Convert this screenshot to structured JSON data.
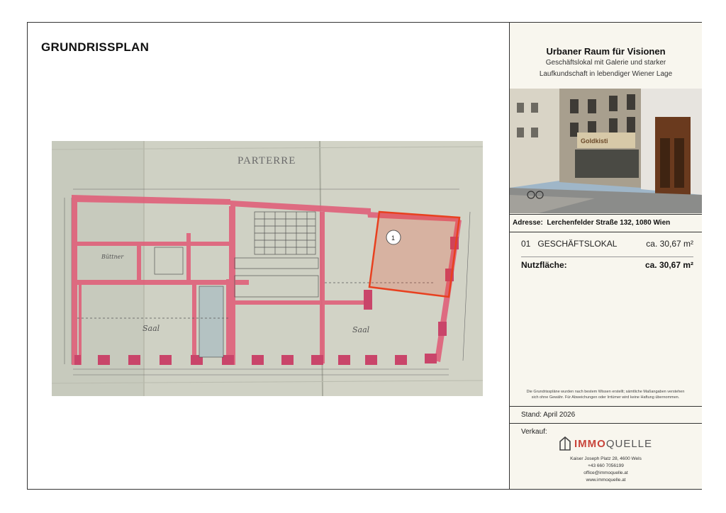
{
  "page": {
    "title": "GRUNDRISSPLAN"
  },
  "plan": {
    "label": "PARTERRE",
    "room_left": "Saal",
    "room_right": "Saal",
    "marker": "1",
    "room_small_left": "Büttner"
  },
  "sidebar": {
    "title": "Urbaner Raum für Visionen",
    "subtitle_1": "Geschäftslokal mit Galerie und starker",
    "subtitle_2": "Laufkundschaft in lebendiger Wiener Lage",
    "photo": {
      "shop_sign": "Goldkisti"
    },
    "address_label": "Adresse:",
    "address_value": "Lerchenfelder Straße 132, 1080 Wien",
    "unit": {
      "number": "01",
      "name": "GESCHÄFTSLOKAL",
      "area": "ca. 30,67 m²"
    },
    "usable_label": "Nutzfläche:",
    "usable_value": "ca. 30,67 m²",
    "disclaimer_1": "Die Grundrisspläne wurden nach bestem Wissen erstellt; sämtliche Maßangaben verstehen",
    "disclaimer_2": "sich ohne Gewähr. Für Abweichungen oder Irrtümer wird keine Haftung übernommen.",
    "stand": "Stand: April 2026",
    "verkauf": "Verkauf:",
    "logo_a": "IMMO",
    "logo_b": "QUELLE",
    "contact": {
      "street": "Kaiser Joseph Platz 28, 4600 Wels",
      "phone": "+43 660 7056199",
      "email": "office@immoquelle.at",
      "web": "www.immoquelle.at"
    }
  },
  "colors": {
    "wall": "#e0607a",
    "highlight": "#e8401f",
    "brand": "#c8443a"
  }
}
